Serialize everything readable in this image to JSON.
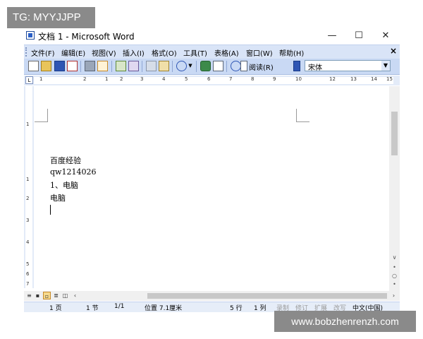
{
  "watermarks": {
    "top": "TG: MYYJJPP",
    "bottom": "www.bobzhenrenzh.com"
  },
  "window": {
    "title": "文档 1 - Microsoft Word",
    "controls": {
      "minimize": "—",
      "maximize": "☐",
      "close": "✕"
    }
  },
  "menubar": {
    "items": [
      "文件(F)",
      "编辑(E)",
      "视图(V)",
      "插入(I)",
      "格式(O)",
      "工具(T)",
      "表格(A)",
      "窗口(W)",
      "帮助(H)"
    ],
    "close": "×"
  },
  "toolbar": {
    "reading": "阅读(R)",
    "font": "宋体",
    "font_arrow": "▼"
  },
  "ruler": {
    "horizontal": [
      "1",
      "2",
      "1",
      "2",
      "3",
      "4",
      "5",
      "6",
      "7",
      "8",
      "9",
      "10",
      "12",
      "13",
      "14",
      "15"
    ],
    "vertical": [
      "1",
      "1",
      "2",
      "3",
      "4",
      "5",
      "6",
      "7"
    ]
  },
  "document": {
    "lines": [
      "百度经验",
      "qw1214026",
      "1、电脑",
      "电脑"
    ]
  },
  "statusbar": {
    "page": "1 页",
    "section": "1 节",
    "page_of": "1/1",
    "position": "位置 7.1厘米",
    "line": "5 行",
    "column": "1 列",
    "rec": "录制",
    "trk": "修订",
    "ext": "扩展",
    "ovr": "改写",
    "language": "中文(中国)"
  }
}
